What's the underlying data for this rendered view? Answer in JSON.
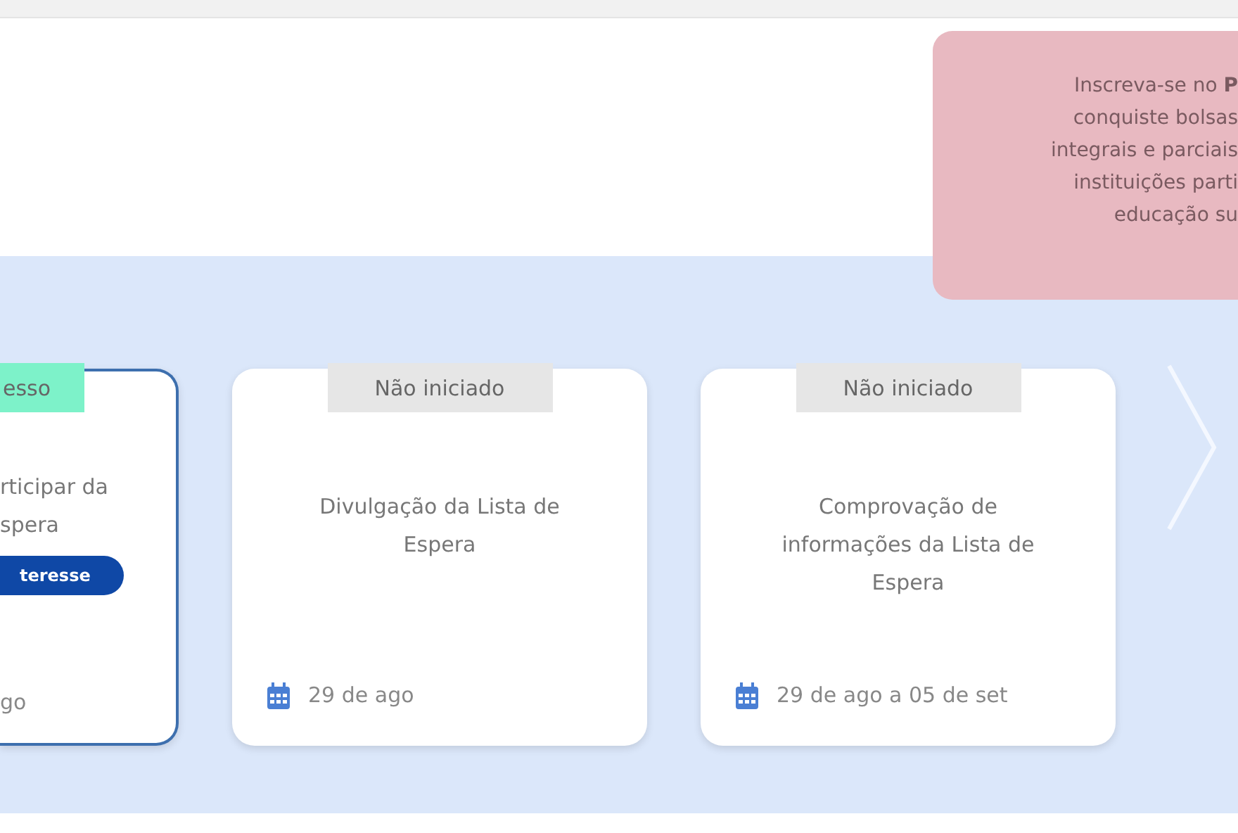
{
  "promo": {
    "lines": [
      "Inscreva-se no **P**",
      "conquiste bolsas",
      "integrais e parciais",
      "instituições parti",
      "educação su"
    ]
  },
  "steps": [
    {
      "status": "esso",
      "color": "#7df2c9",
      "title_lines": [
        "rticipar da",
        "spera"
      ],
      "action": "teresse",
      "date": "go",
      "current": true,
      "partial": true
    },
    {
      "status": "Não iniciado",
      "color": "#e6e6e6",
      "title_lines": [
        "Divulgação da Lista de",
        "Espera"
      ],
      "date": "29 de ago",
      "current": false,
      "partial": false
    },
    {
      "status": "Não iniciado",
      "color": "#e6e6e6",
      "title_lines": [
        "Comprovação de",
        "informações da Lista de",
        "Espera"
      ],
      "date": "29 de ago a 05 de set",
      "current": false,
      "partial": false
    }
  ]
}
